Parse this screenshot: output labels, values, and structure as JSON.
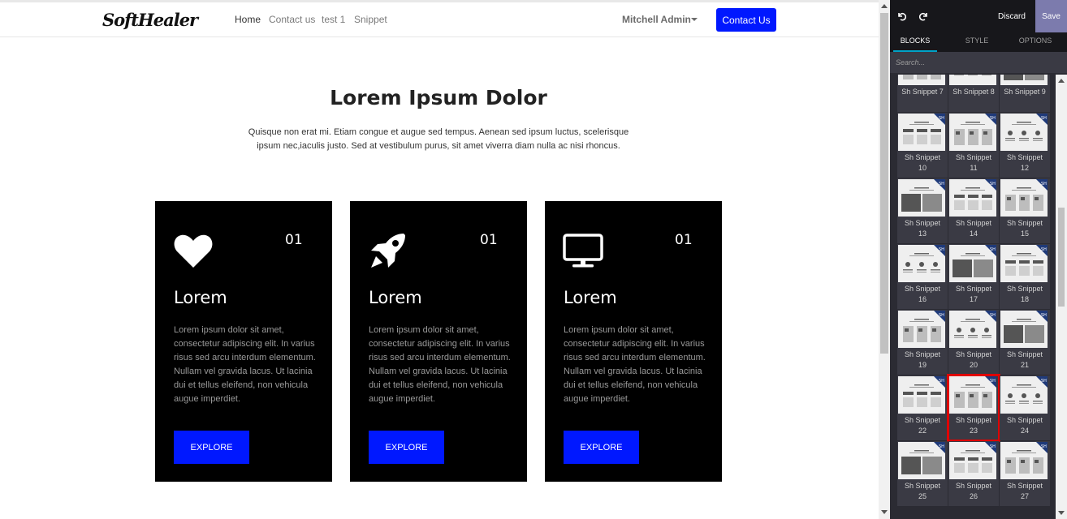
{
  "site": {
    "logo": "SoftHealer",
    "nav": [
      "Home",
      "Contact us",
      "test 1",
      "Snippet"
    ],
    "user": "Mitchell Admin",
    "contact_button": "Contact Us",
    "hero": {
      "title": "Lorem Ipsum Dolor",
      "text": "Quisque non erat mi. Etiam congue et augue sed tempus. Aenean sed ipsum luctus, scelerisque ipsum nec,iaculis justo. Sed at vestibulum purus, sit amet viverra diam nulla ac nisi rhoncus."
    },
    "cards": [
      {
        "icon": "heart-icon",
        "number": "01",
        "title": "Lorem",
        "text": "Lorem ipsum dolor sit amet, consectetur adipiscing elit. In varius risus sed arcu interdum elementum. Nullam vel gravida lacus. Ut lacinia dui et tellus eleifend, non vehicula augue imperdiet.",
        "button": "EXPLORE"
      },
      {
        "icon": "rocket-icon",
        "number": "01",
        "title": "Lorem",
        "text": "Lorem ipsum dolor sit amet, consectetur adipiscing elit. In varius risus sed arcu interdum elementum. Nullam vel gravida lacus. Ut lacinia dui et tellus eleifend, non vehicula augue imperdiet.",
        "button": "EXPLORE"
      },
      {
        "icon": "monitor-icon",
        "number": "01",
        "title": "Lorem",
        "text": "Lorem ipsum dolor sit amet, consectetur adipiscing elit. In varius risus sed arcu interdum elementum. Nullam vel gravida lacus. Ut lacinia dui et tellus eleifend, non vehicula augue imperdiet.",
        "button": "EXPLORE"
      }
    ]
  },
  "panel": {
    "discard": "Discard",
    "save": "Save",
    "tabs": [
      "BLOCKS",
      "STYLE",
      "OPTIONS"
    ],
    "active_tab": "BLOCKS",
    "search_placeholder": "Search...",
    "snippets": [
      [
        "Sh Snippet 7"
      ],
      [
        "Sh Snippet 8"
      ],
      [
        "Sh Snippet 9"
      ],
      [
        "Sh Snippet",
        "10"
      ],
      [
        "Sh Snippet",
        "11"
      ],
      [
        "Sh Snippet",
        "12"
      ],
      [
        "Sh Snippet",
        "13"
      ],
      [
        "Sh Snippet",
        "14"
      ],
      [
        "Sh Snippet",
        "15"
      ],
      [
        "Sh Snippet",
        "16"
      ],
      [
        "Sh Snippet",
        "17"
      ],
      [
        "Sh Snippet",
        "18"
      ],
      [
        "Sh Snippet",
        "19"
      ],
      [
        "Sh Snippet",
        "20"
      ],
      [
        "Sh Snippet",
        "21"
      ],
      [
        "Sh Snippet",
        "22"
      ],
      [
        "Sh Snippet",
        "23"
      ],
      [
        "Sh Snippet",
        "24"
      ],
      [
        "Sh Snippet",
        "25"
      ],
      [
        "Sh Snippet",
        "26"
      ],
      [
        "Sh Snippet",
        "27"
      ]
    ],
    "selected_snippet": "Sh Snippet 23",
    "colors": {
      "accent": "#0018ff",
      "save_bg": "#7c7bad",
      "panel_bg": "#2b2b33",
      "selected_outline": "#e00000",
      "badge": "#1f3a7a"
    }
  }
}
